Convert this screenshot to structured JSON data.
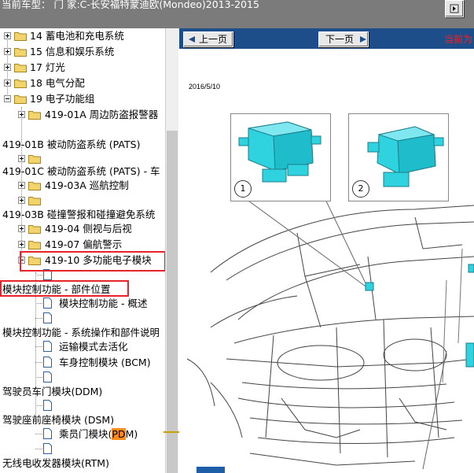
{
  "titlebar": {
    "title": "当前车型： 门 家:C-长安福特蒙迪欧(Mondeo)2013-2015"
  },
  "tree": {
    "items": [
      {
        "label": "14 蓄电池和充电系统"
      },
      {
        "label": "15 信息和娱乐系统"
      },
      {
        "label": "17 灯光"
      },
      {
        "label": "18 电气分配"
      },
      {
        "label": "19 电子功能组"
      },
      {
        "label": "419-01A 周边防盗报警器"
      },
      {
        "label": "419-01B 被动防盗系统 (PATS)"
      },
      {
        "label": "419-01C 被动防盗系统 (PATS) - 车"
      },
      {
        "label": "419-03A 巡航控制"
      },
      {
        "label": "419-03B 碰撞警报和碰撞避免系统"
      },
      {
        "label": "419-04 侧视与后视"
      },
      {
        "label": "419-07 偏航警示"
      },
      {
        "label": "419-10 多功能电子模块"
      },
      {
        "label": "模块控制功能 - 部件位置"
      },
      {
        "label": "模块控制功能 - 概述"
      },
      {
        "label": "模块控制功能 - 系统操作和部件说明"
      },
      {
        "label": "运输模式去活化"
      },
      {
        "label": "车身控制模块 (BCM)"
      },
      {
        "label": "驾驶员车门模块(DDM)"
      },
      {
        "label": "驾驶座前座椅模块 (DSM)"
      },
      {
        "label": "乘员门模块(",
        "highlight": "PD",
        "suffix": "M)"
      },
      {
        "label": "无线电收发器模块(RTM)"
      }
    ]
  },
  "content": {
    "prev_label": "上一页",
    "next_label": "下一页",
    "current_position": "当前为",
    "date": "2016/5/10",
    "callout_1": "1",
    "callout_2": "2"
  },
  "colors": {
    "titlebar": "#7b7b7b",
    "navbar": "#1e4e8a",
    "redbox": "#e8242a",
    "highlight": "#ff8c1a",
    "module": "#2fd3e0"
  }
}
